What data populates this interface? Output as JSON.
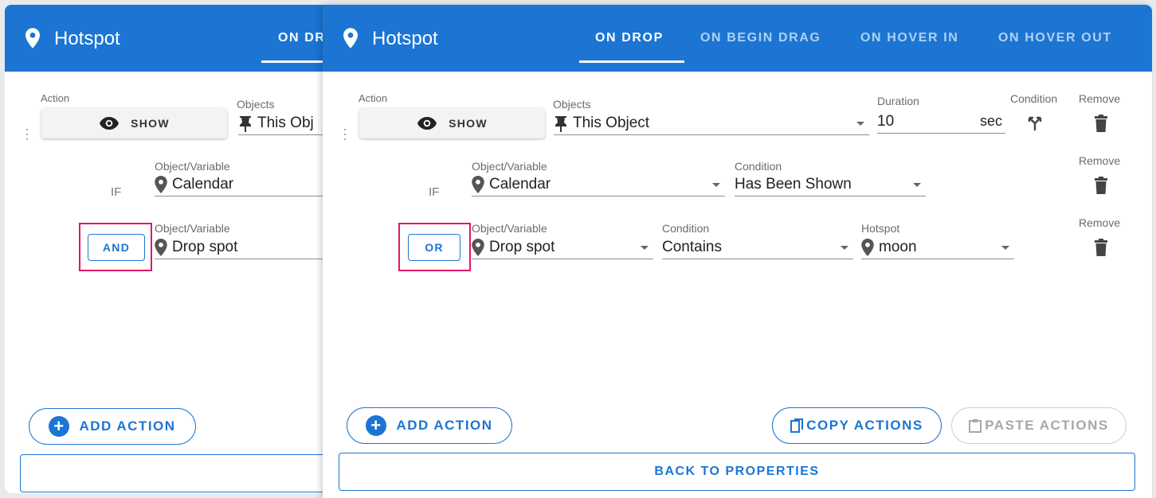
{
  "back_panel": {
    "title": "Hotspot",
    "tab_active": "ON DR",
    "action_label": "Action",
    "objects_label": "Objects",
    "show_label": "SHOW",
    "object_value": "This Obj",
    "if_label": "IF",
    "var_label_1": "Object/Variable",
    "var_value_1": "Calendar",
    "logic_label": "AND",
    "var_label_2": "Object/Variable",
    "var_value_2": "Drop spot",
    "add_action": "ADD ACTION"
  },
  "front_panel": {
    "title": "Hotspot",
    "tabs": [
      "ON DROP",
      "ON BEGIN DRAG",
      "ON HOVER IN",
      "ON HOVER OUT"
    ],
    "action_row": {
      "action_label": "Action",
      "show_label": "SHOW",
      "objects_label": "Objects",
      "object_value": "This Object",
      "duration_label": "Duration",
      "duration_value": "10",
      "duration_unit": "sec",
      "condition_label": "Condition",
      "remove_label": "Remove"
    },
    "condition_row_1": {
      "if_label": "IF",
      "var_label": "Object/Variable",
      "var_value": "Calendar",
      "cond_label": "Condition",
      "cond_value": "Has Been Shown",
      "remove_label": "Remove"
    },
    "condition_row_2": {
      "logic_label": "OR",
      "var_label": "Object/Variable",
      "var_value": "Drop spot",
      "cond_label": "Condition",
      "cond_value": "Contains",
      "hotspot_label": "Hotspot",
      "hotspot_value": "moon",
      "remove_label": "Remove"
    },
    "add_action": "ADD ACTION",
    "copy_actions": "COPY ACTIONS",
    "paste_actions": "PASTE ACTIONS",
    "back_to_properties": "BACK TO PROPERTIES"
  },
  "colors": {
    "primary": "#1c75d2",
    "highlight": "#e0156a",
    "disabled": "#a8a8a8"
  },
  "icons": [
    "location-pin-icon",
    "eye-icon",
    "push-pin-icon",
    "trash-icon",
    "condition-split-icon",
    "add-circle-icon",
    "copy-icon",
    "paste-icon",
    "kebab-menu-icon"
  ]
}
